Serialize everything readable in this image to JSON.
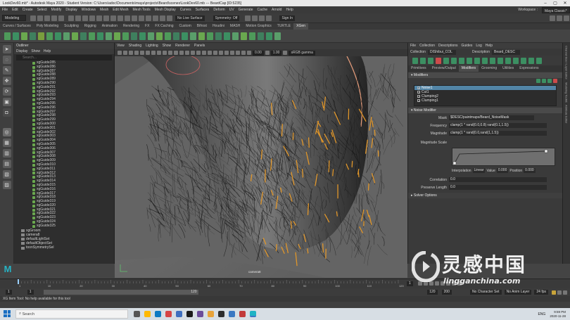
{
  "window": {
    "title": "LookDev60.mb* - Autodesk Maya 2020 - Student Version: C:\\Users\\adoc\\Documents\\maya\\projects\\Beard\\scenes\\LookDev60.mb --- BeardCap [ID:5235]",
    "workspace_label": "Workspace :",
    "workspace_value": "Maya Classic*"
  },
  "menubar": [
    "File",
    "Edit",
    "Create",
    "Select",
    "Modify",
    "Display",
    "Windows",
    "Mesh",
    "Edit Mesh",
    "Mesh Tools",
    "Mesh Display",
    "Curves",
    "Surfaces",
    "Deform",
    "UV",
    "Generate",
    "Cache",
    "Arnold",
    "Help"
  ],
  "toolbar": {
    "mode": "Modeling",
    "live_surface": "No Live Surface",
    "symmetry": "Symmetry: Off",
    "sign_in": "Sign In"
  },
  "shelf_tabs": [
    "Curves / Surfaces",
    "Poly Modeling",
    "Sculpting",
    "Rigging",
    "Animation",
    "Rendering",
    "FX",
    "FX Caching",
    "Custom",
    "Bifrost",
    "Houdini",
    "MASH",
    "Motion Graphics",
    "TURTLE",
    "XGen"
  ],
  "shelf_active": "XGen",
  "outliner": {
    "title": "Outliner",
    "menu": [
      "Display",
      "Show",
      "Help"
    ],
    "search_placeholder": "Search...",
    "guides": [
      "xgGuide285",
      "xgGuide286",
      "xgGuide287",
      "xgGuide288",
      "xgGuide289",
      "xgGuide290",
      "xgGuide291",
      "xgGuide292",
      "xgGuide293",
      "xgGuide294",
      "xgGuide295",
      "xgGuide296",
      "xgGuide297",
      "xgGuide298",
      "xgGuide299",
      "xgGuide300",
      "xgGuide301",
      "xgGuide302",
      "xgGuide303",
      "xgGuide304",
      "xgGuide305",
      "xgGuide306",
      "xgGuide307",
      "xgGuide308",
      "xgGuide309",
      "xgGuide310",
      "xgGuide311",
      "xgGuide312",
      "xgGuide313",
      "xgGuide314",
      "xgGuide315",
      "xgGuide316",
      "xgGuide317",
      "xgGuide318",
      "xgGuide319",
      "xgGuide320",
      "xgGuide321",
      "xgGuide322",
      "xgGuide323",
      "xgGuide324",
      "xgGuide325"
    ],
    "bottom_items": [
      "xgGroom",
      "camera8",
      "defaultLightSet",
      "defaultObjectSet",
      "toonSymmetrySel"
    ]
  },
  "viewport": {
    "menu": [
      "View",
      "Shading",
      "Lighting",
      "Show",
      "Renderer",
      "Panels"
    ],
    "field_a": "0.00",
    "field_b": "1.00",
    "colorspace": "sRGB gamma",
    "camera_label": "camera8"
  },
  "xgen": {
    "menu": [
      "File",
      "Collection",
      "Descriptions",
      "Guides",
      "Log",
      "Help"
    ],
    "collection_label": "Collection",
    "collection_value": "DIShibui_COL",
    "description_label": "Description",
    "description_value": "Beard_DESC",
    "tabs": [
      "Primitives",
      "Preview/Output",
      "Modifiers",
      "Grooming",
      "Utilities",
      "Expressions"
    ],
    "active_tab": "Modifiers",
    "modifiers_header": "Modifiers",
    "modifiers": [
      {
        "name": "Noise1",
        "selected": true
      },
      {
        "name": "Cut1",
        "selected": false
      },
      {
        "name": "Clumping2",
        "selected": false
      },
      {
        "name": "Clumping1",
        "selected": false
      }
    ],
    "noise_header": "Noise Modifier",
    "fields": [
      {
        "label": "Mask",
        "value": "$DESC/paintmaps/Beard_NoiseMask"
      },
      {
        "label": "Frequency",
        "value": "clamp(1 * rand(0.0,0.8) rand(0.1,1.5))"
      },
      {
        "label": "Magnitude",
        "value": "clamp(1 * rand(0.0,rand(1,1.5))"
      }
    ],
    "magnitude_scale_label": "Magnitude Scale",
    "interp_label": "Interpolation",
    "interp_value": "Linear",
    "value_label": "Value",
    "value_value": "0.000",
    "position_label": "Position",
    "position_value": "0.000",
    "correlation_label": "Correlation",
    "correlation_value": "0.0",
    "preserve_label": "Preserve Length",
    "preserve_value": "0.0",
    "solver_header": "Solver Options",
    "side_tabs": [
      "Channel Box / Layer Editor",
      "Modeling Toolkit",
      "Attribute Editor"
    ]
  },
  "timeline": {
    "ticks": [
      "1",
      "10",
      "20",
      "30",
      "40",
      "50",
      "60",
      "70",
      "80",
      "90",
      "100",
      "110",
      "120"
    ],
    "current_frame": "1",
    "range_start": "1",
    "range_start2": "1",
    "range_end": "120",
    "range_end2": "120",
    "anim_end": "200",
    "character_set": "No Character Set",
    "anim_layer": "No Anim Layer",
    "fps": "24 fps"
  },
  "help_line": "XG Item Tool: No help available for this tool",
  "taskbar": {
    "search_placeholder": "Search",
    "language": "ENG",
    "time": "9:59 PM",
    "date": "2020-11-28"
  },
  "watermark": {
    "cn_text": "灵感中国",
    "url_text": "lingganchina.com"
  },
  "colors": {
    "accent": "#5285a6",
    "xgen_green": "#3c8f62",
    "hair_orange": "#e0962a",
    "maya_logo": "#27b3c4"
  }
}
